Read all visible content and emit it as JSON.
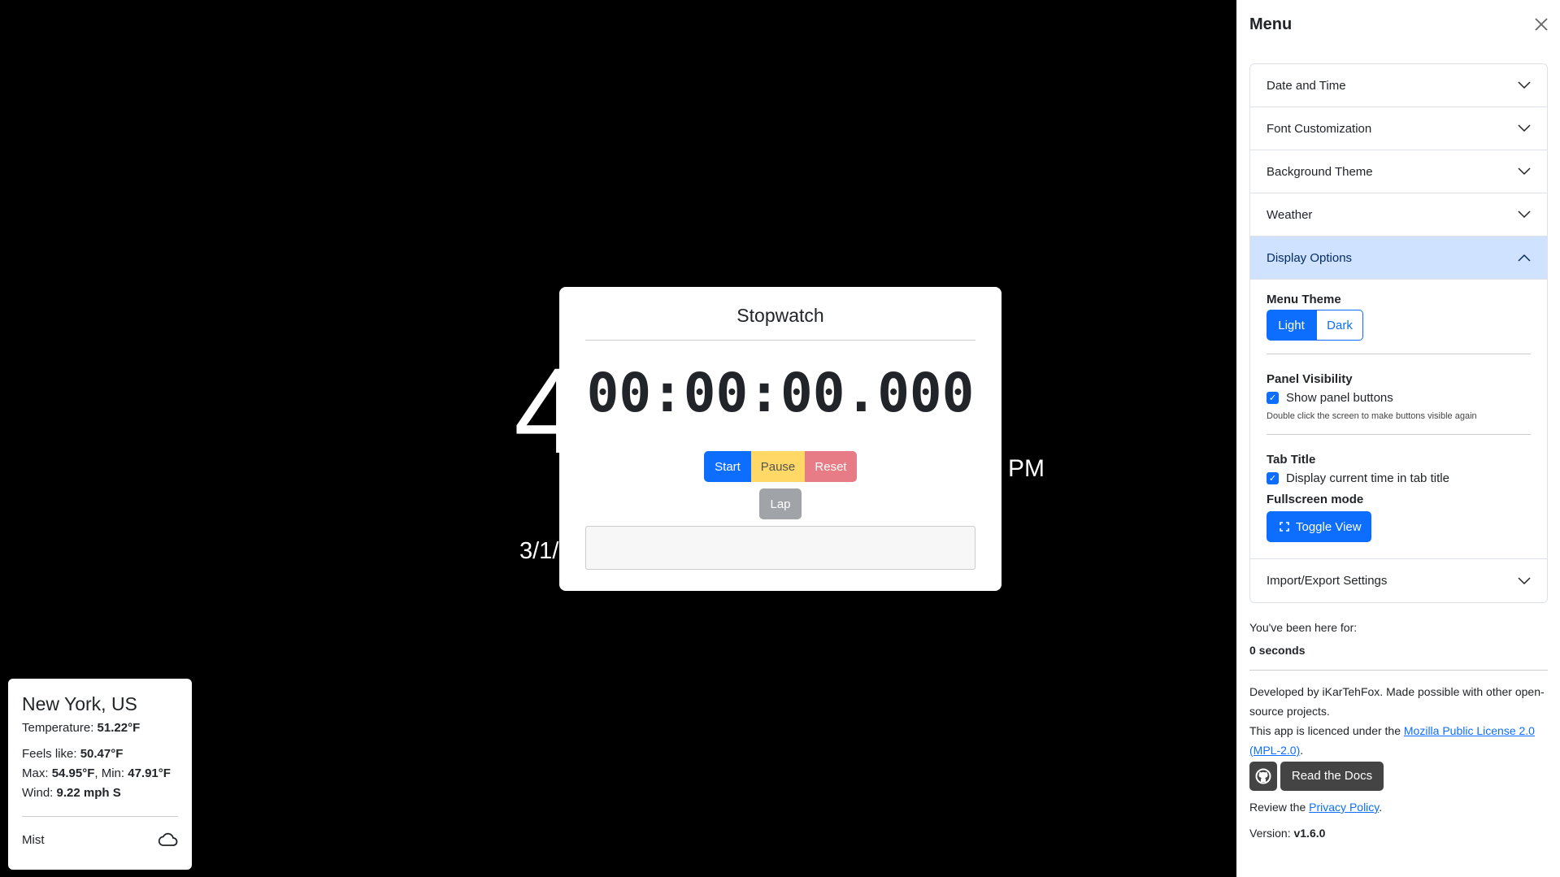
{
  "clock": {
    "time_visible": "4",
    "ampm": "PM",
    "date_visible": "3/1/"
  },
  "stopwatch": {
    "title": "Stopwatch",
    "time": "00:00:00.000",
    "start": "Start",
    "pause": "Pause",
    "reset": "Reset",
    "lap": "Lap",
    "laps_value": ""
  },
  "weather": {
    "city": "New York, US",
    "temp_label": "Temperature: ",
    "temp": "51.22°F",
    "feels_label": "Feels like: ",
    "feels": "50.47°F",
    "max_label": "Max: ",
    "max": "54.95°F",
    "min_label": ", Min: ",
    "min": "47.91°F",
    "wind_label": "Wind: ",
    "wind": "9.22 mph S",
    "condition": "Mist",
    "icon": "cloud-icon"
  },
  "menu": {
    "title": "Menu",
    "sections": [
      "Date and Time",
      "Font Customization",
      "Background Theme",
      "Weather",
      "Display Options",
      "Import/Export Settings"
    ],
    "display": {
      "menu_theme": "Menu Theme",
      "light": "Light",
      "dark": "Dark",
      "selected": "Light",
      "panel_visibility": "Panel Visibility",
      "show_panel": "Show panel buttons",
      "show_panel_checked": true,
      "hint": "Double click the screen to make buttons visible again",
      "tab_title": "Tab Title",
      "tab_time": "Display current time in tab title",
      "tab_time_checked": true,
      "fullscreen": "Fullscreen mode",
      "toggle": "Toggle View"
    },
    "footer": {
      "been_here": "You've been here for:",
      "duration": "0 seconds",
      "developed": "Developed by iKarTehFox. Made possible with other open-source projects.",
      "license_pre": "This app is licenced under the ",
      "license_link": "Mozilla Public License 2.0 (MPL-2.0)",
      "license_post": ".",
      "docs": "Read the Docs",
      "review_pre": "Review the ",
      "privacy": "Privacy Policy",
      "review_post": ".",
      "version_label": "Version: ",
      "version": "v1.6.0"
    },
    "colors": {
      "accent": "#0d6efd",
      "open_section_bg": "#cfe2ff"
    }
  }
}
